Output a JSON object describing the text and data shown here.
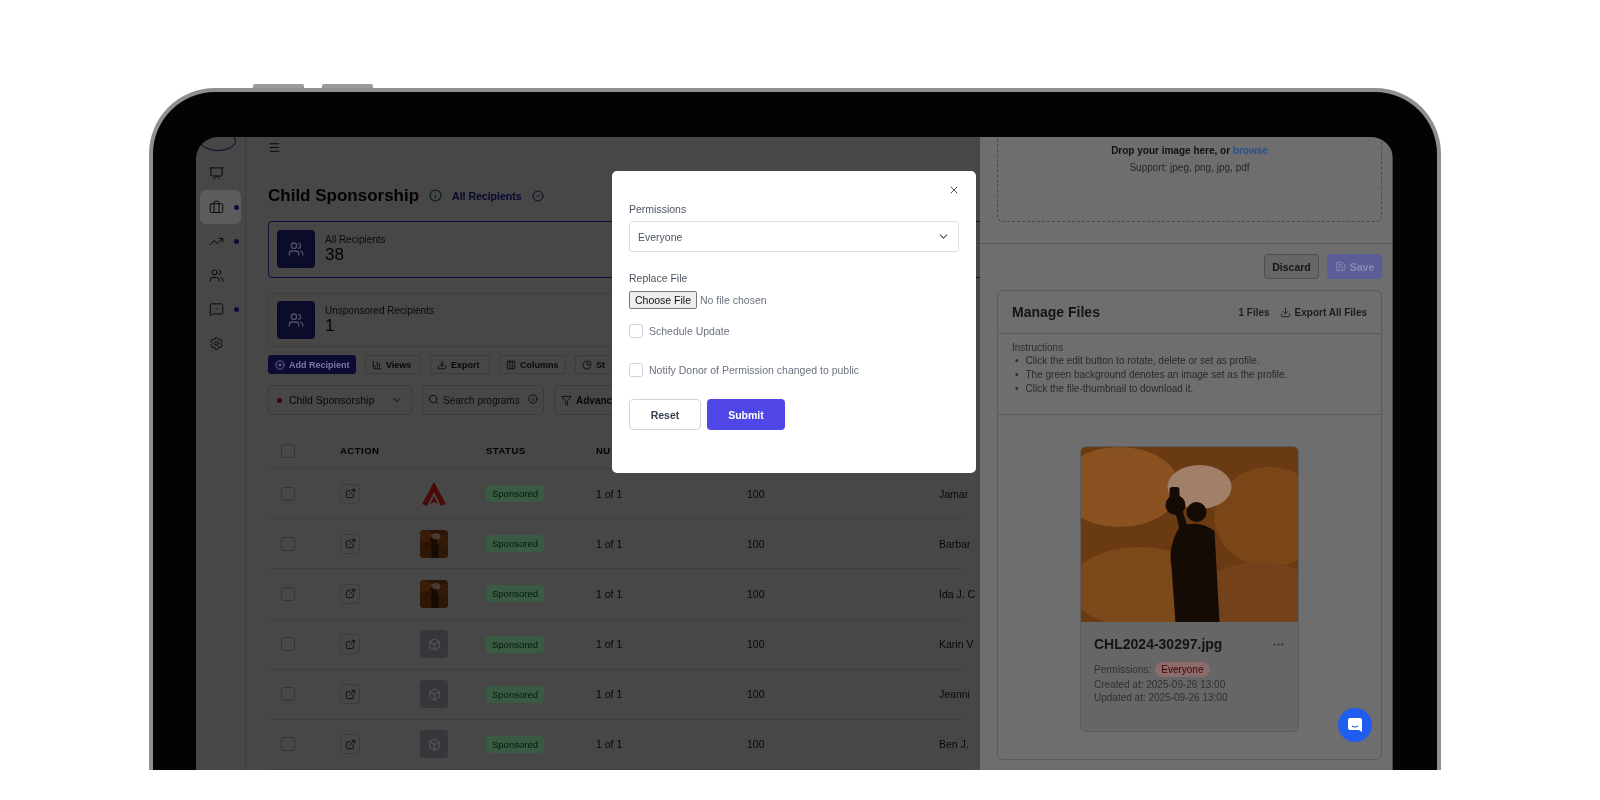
{
  "sidebar": {
    "items": [
      {
        "kind": "chart",
        "selected": false,
        "dot": false
      },
      {
        "kind": "briefcase",
        "selected": true,
        "dot": true
      },
      {
        "kind": "trend",
        "selected": false,
        "dot": true
      },
      {
        "kind": "people",
        "selected": false,
        "dot": false
      },
      {
        "kind": "chat",
        "selected": false,
        "dot": true
      },
      {
        "kind": "settings",
        "selected": false,
        "dot": false
      }
    ]
  },
  "header": {
    "title": "Child Sponsorship",
    "view": "All Recipients"
  },
  "stats": [
    {
      "label": "All Recipients",
      "value": "38",
      "selected": true
    },
    {
      "label": "Unsponsored Recipients",
      "value": "1",
      "selected": false
    }
  ],
  "toolbar": [
    {
      "kind": "add",
      "label": "Add Recipient"
    },
    {
      "kind": "views",
      "label": "Views"
    },
    {
      "kind": "export",
      "label": "Export"
    },
    {
      "kind": "columns",
      "label": "Columns"
    },
    {
      "kind": "stats",
      "label": "St"
    }
  ],
  "filters": {
    "program": "Child Sponsorship",
    "search_placeholder": "Search programs",
    "advanced": "Advanc"
  },
  "table": {
    "select_all_checked": false,
    "columns": [
      "ACTION",
      "STATUS",
      "NU"
    ],
    "rows": [
      {
        "checked": false,
        "kind": "logo",
        "status": "Sponsored",
        "count": "1 of 1",
        "amount": "100",
        "name": "Jamar"
      },
      {
        "checked": false,
        "status": "Sponsored",
        "count": "1 of 1",
        "amount": "100",
        "name": "Barbar"
      },
      {
        "checked": false,
        "status": "Sponsored",
        "count": "1 of 1",
        "amount": "100",
        "name": "Ida J. C"
      },
      {
        "checked": false,
        "kind": "placeholder",
        "status": "Sponsored",
        "count": "1 of 1",
        "amount": "100",
        "name": "Karin V"
      },
      {
        "checked": false,
        "kind": "placeholder",
        "status": "Sponsored",
        "count": "1 of 1",
        "amount": "100",
        "name": "Jeanni"
      },
      {
        "checked": false,
        "kind": "placeholder",
        "status": "Sponsored",
        "count": "1 of 1",
        "amount": "100",
        "name": "Ben J."
      }
    ]
  },
  "drawer": {
    "dropzone": {
      "text": "Drop your image here, or",
      "link": "browse",
      "hint": "Support: jpeg, png, jpg, pdf"
    },
    "discard": "Discard",
    "save": "Save",
    "manage_files": {
      "title": "Manage Files",
      "count": "1 Files",
      "export": "Export All Files",
      "instructions_title": "Instructions",
      "bullet": "•",
      "instructions": [
        "Click the edit button to rotate, delete or set as profile.",
        "The green background denotes an image set as the profile.",
        "Click the file-thumbnail to download it."
      ],
      "files": [
        {
          "name": "CHL2024-30297.jpg",
          "permissions_label": "Permissions:",
          "permission": "Everyone",
          "created": "Created at: 2025-09-26 13:00",
          "updated": "Updated at: 2025-09-26 13:00"
        }
      ]
    }
  },
  "modal": {
    "permissions_label": "Permissions",
    "permission": "Everyone",
    "replace_label": "Replace File",
    "choose_button": "Choose File",
    "file_status": "No file chosen",
    "options": [
      {
        "label": "Schedule Update",
        "checked": false
      },
      {
        "label": "Notify Donor of Permission changed to public",
        "checked": false
      }
    ],
    "reset": "Reset",
    "submit": "Submit"
  }
}
